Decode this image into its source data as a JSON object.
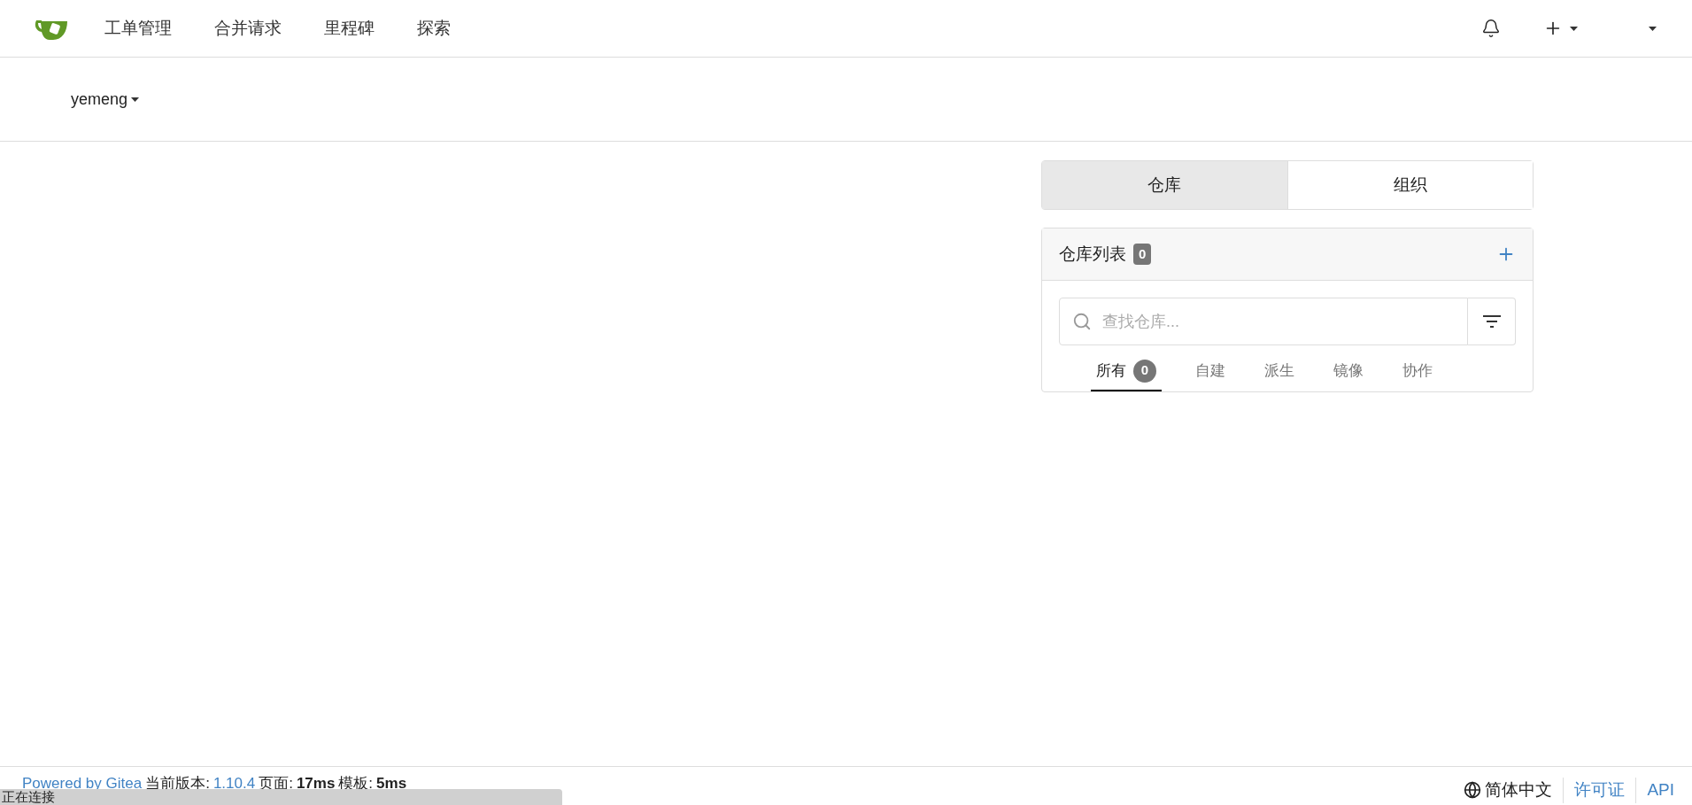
{
  "navbar": {
    "items": [
      {
        "label": "工单管理"
      },
      {
        "label": "合并请求"
      },
      {
        "label": "里程碑"
      },
      {
        "label": "探索"
      }
    ]
  },
  "context": {
    "user": "yemeng"
  },
  "switch_tabs": [
    {
      "label": "仓库",
      "selected": true
    },
    {
      "label": "组织",
      "selected": false
    }
  ],
  "repo_list": {
    "title": "仓库列表",
    "count": "0",
    "search": {
      "placeholder": "查找仓库..."
    },
    "filters": [
      {
        "label": "所有",
        "count": "0",
        "selected": true
      },
      {
        "label": "自建",
        "selected": false
      },
      {
        "label": "派生",
        "selected": false
      },
      {
        "label": "镜像",
        "selected": false
      },
      {
        "label": "协作",
        "selected": false
      }
    ]
  },
  "footer": {
    "powered": "Powered by Gitea",
    "version_label": "当前版本:",
    "version": "1.10.4",
    "page_label": "页面:",
    "page_time": "17ms",
    "template_label": "模板:",
    "template_time": "5ms",
    "language": "简体中文",
    "links": [
      "许可证",
      "API"
    ]
  },
  "status_bubble": "正在连接"
}
